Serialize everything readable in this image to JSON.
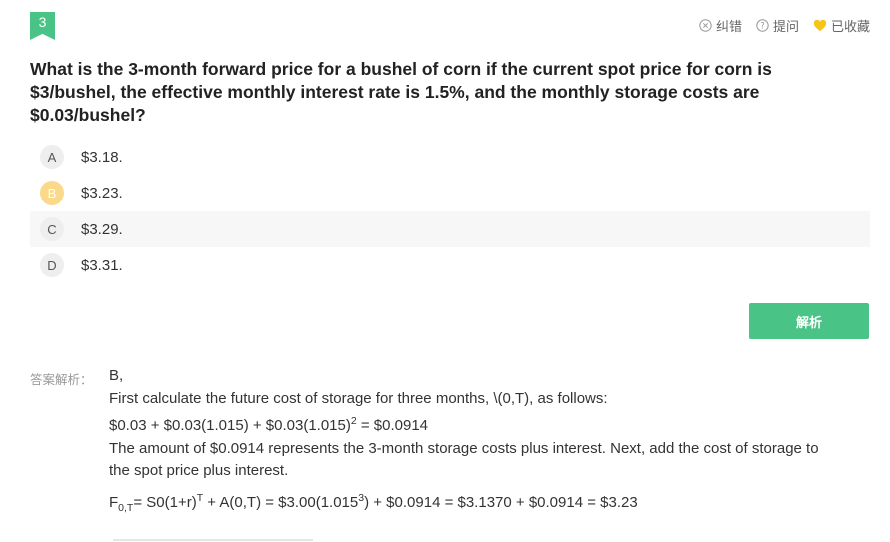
{
  "question_number": "3",
  "tools": {
    "report_label": "纠错",
    "ask_label": "提问",
    "favorite_label": "已收藏"
  },
  "question": {
    "text": "What is the 3-month forward price for a bushel of corn if the current spot price for corn is $3/bushel, the effective monthly interest rate is 1.5%, and the monthly storage costs are $0.03/bushel?"
  },
  "options": [
    {
      "letter": "A",
      "text": "$3.18."
    },
    {
      "letter": "B",
      "text": "$3.23."
    },
    {
      "letter": "C",
      "text": "$3.29."
    },
    {
      "letter": "D",
      "text": "$3.31."
    }
  ],
  "selected_option": "B",
  "analysis_button_label": "解析",
  "answer": {
    "label": "答案解析：",
    "choice": "B,",
    "line1": "First calculate the future cost of storage for three months, \\(0,T), as follows:",
    "line2_main": "$0.03 + $0.03(1.015) + $0.03(1.015)",
    "line2_sup": "2",
    "line2_end": " = $0.0914",
    "line3": "The amount of $0.0914 represents the 3-month storage costs plus interest. Next, add the cost of storage to the spot price plus interest.",
    "formula": {
      "f": "F",
      "f_sub": "0,T",
      "part1": "= S0(1+r)",
      "sup_t": "T",
      "part2": " + A(0,T) = $3.00(1.015",
      "sup_3": "3",
      "part3": ") + $0.0914 = $3.1370 + $0.0914 = $3.23"
    }
  },
  "colors": {
    "accent": "#49c486",
    "selected": "#fbd98a",
    "heart": "#f5c518"
  }
}
